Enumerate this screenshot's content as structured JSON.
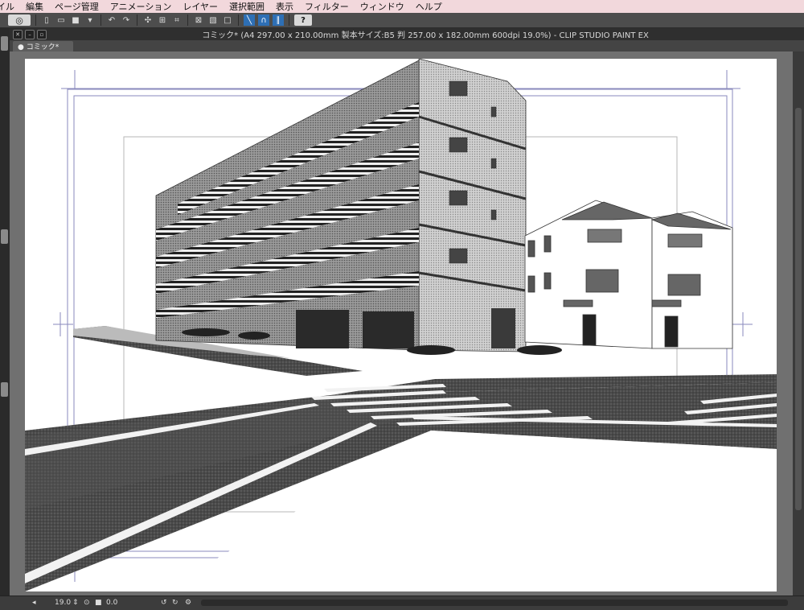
{
  "menu": {
    "items": [
      "イル",
      "編集",
      "ページ管理",
      "アニメーション",
      "レイヤー",
      "選択範囲",
      "表示",
      "フィルター",
      "ウィンドウ",
      "ヘルプ"
    ]
  },
  "toolbar": {
    "icons": [
      "clip-studio-logo-icon",
      "new-file-icon",
      "open-folder-icon",
      "save-icon",
      "save-menu-icon",
      "undo-icon",
      "redo-icon",
      "transform-icon",
      "select-icon",
      "fit-icon",
      "clear-icon",
      "fill-icon",
      "erase-icon",
      "ruler-icon",
      "snap-icon",
      "snap-special-icon",
      "help-icon"
    ],
    "help_label": "?"
  },
  "window": {
    "title": "コミック* (A4 297.00 x 210.00mm 製本サイズ:B5 判 257.00 x 182.00mm 600dpi 19.0%)  - CLIP STUDIO PAINT EX",
    "tab_label": "● コミック*"
  },
  "status": {
    "zoom": "19.0",
    "rotation": "0.0"
  },
  "colors": {
    "menubar_bg": "#f2d8dc",
    "ui_dark": "#3a3a3a",
    "guide_blue": "#5a5aa0"
  }
}
